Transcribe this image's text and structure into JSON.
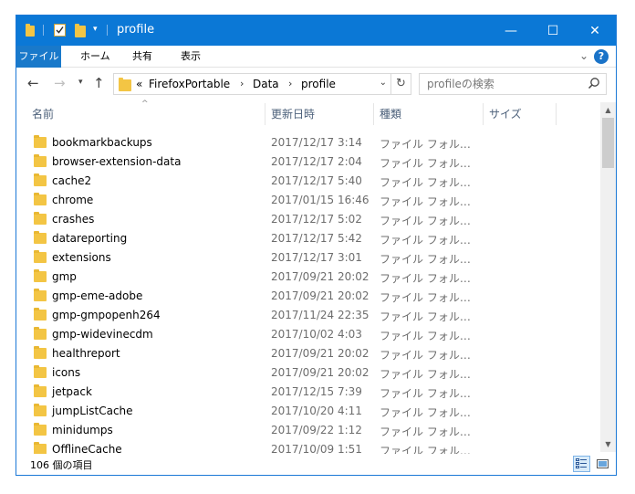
{
  "window": {
    "title": "profile",
    "controls": {
      "minimize": "—",
      "maximize": "☐",
      "close": "✕"
    }
  },
  "ribbon": {
    "tabs": [
      "ファイル",
      "ホーム",
      "共有",
      "表示"
    ]
  },
  "address": {
    "overflow": "«",
    "crumbs": [
      "FirefoxPortable",
      "Data",
      "profile"
    ]
  },
  "search": {
    "placeholder": "profileの検索"
  },
  "columns": [
    "名前",
    "更新日時",
    "種類",
    "サイズ"
  ],
  "files": [
    {
      "name": "bookmarkbackups",
      "date": "2017/12/17 3:14",
      "type": "ファイル フォル…"
    },
    {
      "name": "browser-extension-data",
      "date": "2017/12/17 2:04",
      "type": "ファイル フォル…"
    },
    {
      "name": "cache2",
      "date": "2017/12/17 5:40",
      "type": "ファイル フォル…"
    },
    {
      "name": "chrome",
      "date": "2017/01/15 16:46",
      "type": "ファイル フォル…"
    },
    {
      "name": "crashes",
      "date": "2017/12/17 5:02",
      "type": "ファイル フォル…"
    },
    {
      "name": "datareporting",
      "date": "2017/12/17 5:42",
      "type": "ファイル フォル…"
    },
    {
      "name": "extensions",
      "date": "2017/12/17 3:01",
      "type": "ファイル フォル…"
    },
    {
      "name": "gmp",
      "date": "2017/09/21 20:02",
      "type": "ファイル フォル…"
    },
    {
      "name": "gmp-eme-adobe",
      "date": "2017/09/21 20:02",
      "type": "ファイル フォル…"
    },
    {
      "name": "gmp-gmpopenh264",
      "date": "2017/11/24 22:35",
      "type": "ファイル フォル…"
    },
    {
      "name": "gmp-widevinecdm",
      "date": "2017/10/02 4:03",
      "type": "ファイル フォル…"
    },
    {
      "name": "healthreport",
      "date": "2017/09/21 20:02",
      "type": "ファイル フォル…"
    },
    {
      "name": "icons",
      "date": "2017/09/21 20:02",
      "type": "ファイル フォル…"
    },
    {
      "name": "jetpack",
      "date": "2017/12/15 7:39",
      "type": "ファイル フォル…"
    },
    {
      "name": "jumpListCache",
      "date": "2017/10/20 4:11",
      "type": "ファイル フォル…"
    },
    {
      "name": "minidumps",
      "date": "2017/09/22 1:12",
      "type": "ファイル フォル…"
    },
    {
      "name": "OfflineCache",
      "date": "2017/10/09 1:51",
      "type": "ファイル フォル…"
    }
  ],
  "status": {
    "item_count": "106 個の項目"
  },
  "colors": {
    "titlebar": "#0b78d6",
    "file_tab": "#1979ca",
    "folder": "#f3c544"
  }
}
